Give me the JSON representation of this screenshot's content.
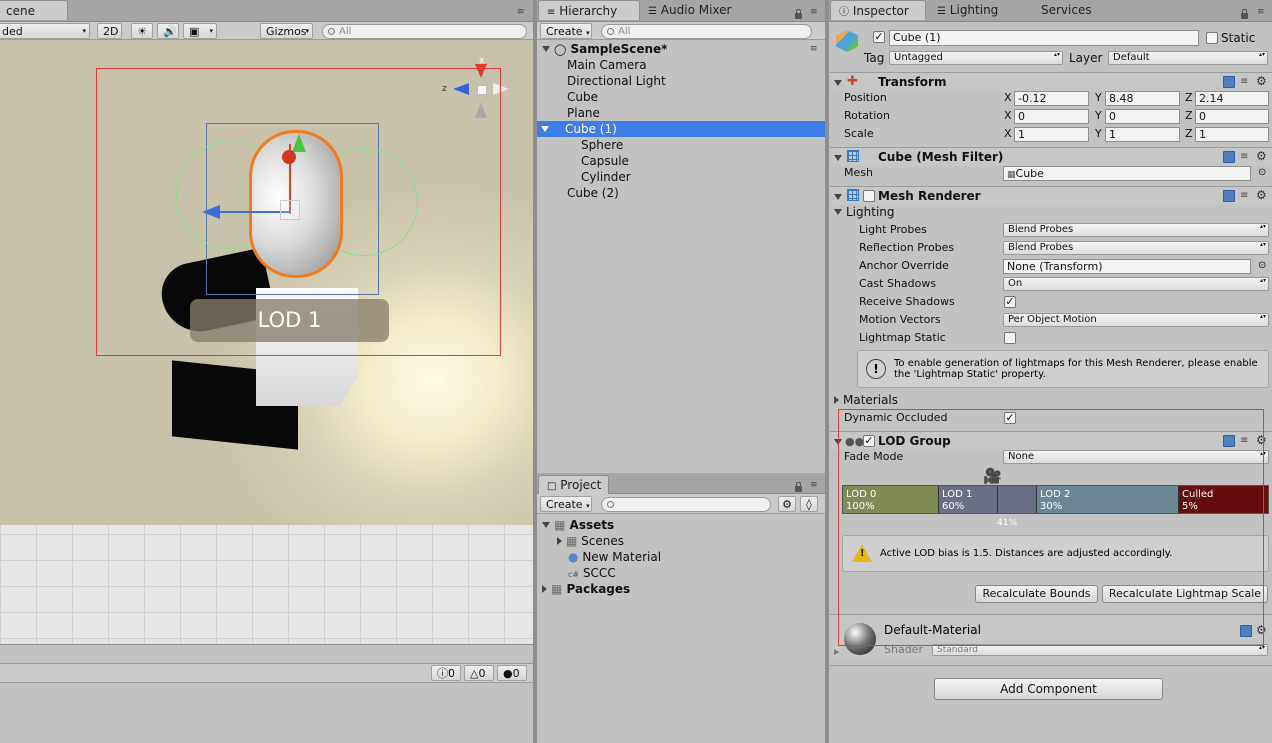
{
  "scene": {
    "tab_label": "cene",
    "shading_mode": "ded",
    "btn_2d": "2D",
    "gizmos_label": "Gizmos",
    "search_placeholder": "All",
    "lod_label": "LOD 1",
    "console": {
      "info_count": "0",
      "warn_count": "0",
      "error_count": "0"
    }
  },
  "hierarchy": {
    "tab_label": "Hierarchy",
    "tab_audio": "Audio Mixer",
    "create_label": "Create",
    "search_placeholder": "All",
    "scene_name": "SampleScene*",
    "items": [
      "Main Camera",
      "Directional Light",
      "Cube",
      "Plane",
      "Cube (1)",
      "Sphere",
      "Capsule",
      "Cylinder",
      "Cube (2)"
    ]
  },
  "project": {
    "tab_label": "Project",
    "create_label": "Create",
    "items": [
      "Assets",
      "Scenes",
      "New Material",
      "SCCC",
      "Packages"
    ]
  },
  "inspector": {
    "tab_label": "Inspector",
    "tab_lighting": "Lighting",
    "tab_services": "Services",
    "object_name": "Cube (1)",
    "static_label": "Static",
    "tag_label": "Tag",
    "tag_value": "Untagged",
    "layer_label": "Layer",
    "layer_value": "Default",
    "transform": {
      "title": "Transform",
      "position_label": "Position",
      "rotation_label": "Rotation",
      "scale_label": "Scale",
      "x": "X",
      "y": "Y",
      "z": "Z",
      "position": [
        "-0.12",
        "8.48",
        "2.14"
      ],
      "rotation": [
        "0",
        "0",
        "0"
      ],
      "scale": [
        "1",
        "1",
        "1"
      ]
    },
    "mesh_filter": {
      "title": "Cube (Mesh Filter)",
      "mesh_label": "Mesh",
      "mesh_value": "Cube"
    },
    "mesh_renderer": {
      "title": "Mesh Renderer",
      "lighting_label": "Lighting",
      "light_probes_label": "Light Probes",
      "light_probes_value": "Blend Probes",
      "reflection_probes_label": "Reflection Probes",
      "reflection_probes_value": "Blend Probes",
      "anchor_override_label": "Anchor Override",
      "anchor_override_value": "None (Transform)",
      "cast_shadows_label": "Cast Shadows",
      "cast_shadows_value": "On",
      "receive_shadows_label": "Receive Shadows",
      "motion_vectors_label": "Motion Vectors",
      "motion_vectors_value": "Per Object Motion",
      "lightmap_static_label": "Lightmap Static",
      "info_text_1": "To enable generation of lightmaps for this Mesh Renderer, please enable",
      "info_text_2": "the 'Lightmap Static' property.",
      "materials_label": "Materials",
      "dynamic_occluded_label": "Dynamic Occluded"
    },
    "lod_group": {
      "title": "LOD Group",
      "fade_mode_label": "Fade Mode",
      "fade_mode_value": "None",
      "bars": [
        {
          "name": "LOD 0",
          "pct": "100%",
          "color": "#7f8a55"
        },
        {
          "name": "LOD 1",
          "pct": "60%",
          "color": "#6a6f83"
        },
        {
          "name": "LOD 2",
          "pct": "30%",
          "color": "#6a8793"
        },
        {
          "name": "Culled",
          "pct": "5%",
          "color": "#650d0d"
        }
      ],
      "marker_pct": "41%",
      "warning": "Active LOD bias is 1.5. Distances are adjusted accordingly.",
      "recalc_bounds": "Recalculate Bounds",
      "recalc_lightmap": "Recalculate Lightmap Scale"
    },
    "material": {
      "name": "Default-Material",
      "shader_label": "Shader",
      "shader_value": "Standard"
    },
    "add_component": "Add Component"
  }
}
